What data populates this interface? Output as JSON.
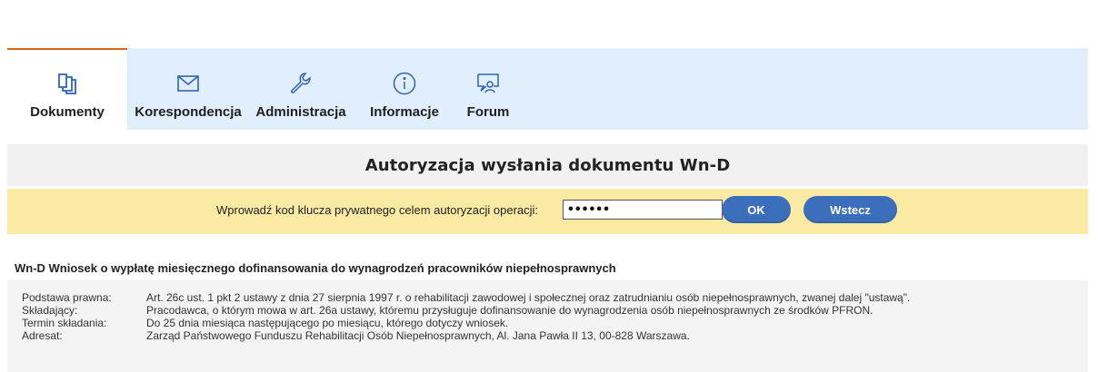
{
  "nav": {
    "items": [
      {
        "label": "Dokumenty",
        "icon": "documents-icon",
        "active": true
      },
      {
        "label": "Korespondencja",
        "icon": "envelope-icon",
        "active": false
      },
      {
        "label": "Administracja",
        "icon": "wrench-icon",
        "active": false
      },
      {
        "label": "Informacje",
        "icon": "info-icon",
        "active": false
      },
      {
        "label": "Forum",
        "icon": "forum-icon",
        "active": false
      }
    ]
  },
  "page_title": "Autoryzacja wysłania dokumentu Wn-D",
  "auth": {
    "label": "Wprowadź kod klucza prywatnego celem autoryzacji operacji:",
    "key_value": "••••••",
    "ok_label": "OK",
    "back_label": "Wstecz"
  },
  "document": {
    "heading": "Wn-D Wniosek o wypłatę miesięcznego dofinansowania do wynagrodzeń pracowników niepełnosprawnych",
    "details": [
      {
        "key": "Podstawa prawna:",
        "value": "Art. 26c ust. 1 pkt 2 ustawy z dnia 27 sierpnia 1997 r. o rehabilitacji zawodowej i społecznej oraz zatrudnianiu osób niepełnosprawnych, zwanej dalej \"ustawą\"."
      },
      {
        "key": "Składający:",
        "value": "Pracodawca, o którym mowa w art. 26a ustawy, któremu przysługuje dofinansowanie do wynagrodzenia osób niepełnosprawnych ze środków PFRON."
      },
      {
        "key": "Termin składania:",
        "value": "Do 25 dnia miesiąca następującego po miesiącu, którego dotyczy wniosek."
      },
      {
        "key": "Adresat:",
        "value": "Zarząd Państwowego Funduszu Rehabilitacji Osób Niepełnosprawnych, Al. Jana Pawła II 13, 00-828 Warszawa."
      }
    ]
  },
  "colors": {
    "nav_bg": "#e1eefb",
    "active_accent": "#d4691e",
    "title_bg": "#f1f1f1",
    "auth_bg": "#fbeaa4",
    "button_bg": "#3b6fbc",
    "details_bg": "#f4f4f4",
    "icon_stroke": "#2f63b4"
  }
}
